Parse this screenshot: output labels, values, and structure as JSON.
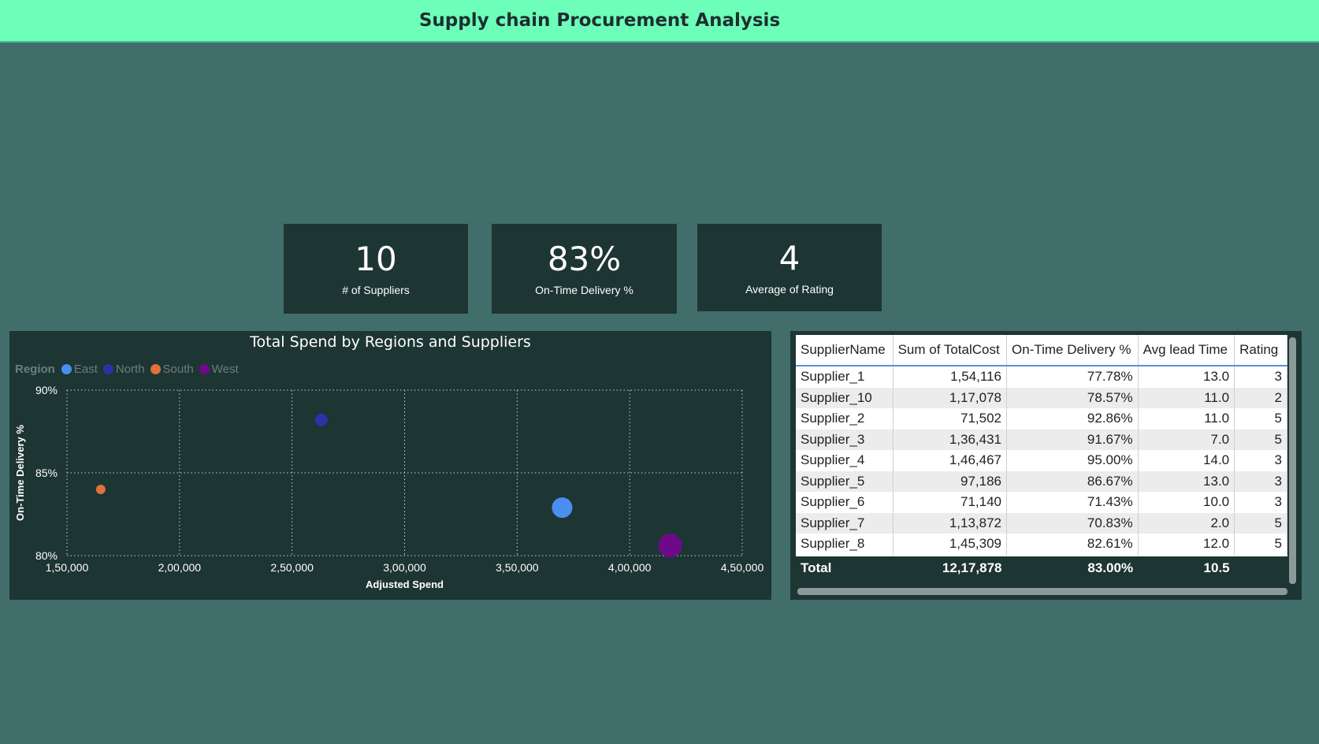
{
  "header": {
    "title": "Supply chain Procurement Analysis"
  },
  "cards": [
    {
      "value": "10",
      "label": "# of Suppliers"
    },
    {
      "value": "83%",
      "label": "On-Time Delivery %"
    },
    {
      "value": "4",
      "label": "Average of Rating"
    }
  ],
  "chart_data": {
    "type": "scatter",
    "title": "Total Spend by Regions and Suppliers",
    "xlabel": "Adjusted Spend",
    "ylabel": "On-Time Delivery %",
    "xlim": [
      150000,
      450000
    ],
    "ylim": [
      80,
      90
    ],
    "x_ticks": [
      "1,50,000",
      "2,00,000",
      "2,50,000",
      "3,00,000",
      "3,50,000",
      "4,00,000",
      "4,50,000"
    ],
    "y_ticks": [
      "80%",
      "85%",
      "90%"
    ],
    "grid": true,
    "legend_title": "Region",
    "legend_position": "top-left",
    "series": [
      {
        "name": "East",
        "color": "#4a8ff0",
        "points": [
          {
            "x": 370000,
            "y": 82.9,
            "size": "large"
          }
        ]
      },
      {
        "name": "North",
        "color": "#2e31a6",
        "points": [
          {
            "x": 263000,
            "y": 88.2,
            "size": "medium"
          }
        ]
      },
      {
        "name": "South",
        "color": "#e0703f",
        "points": [
          {
            "x": 165000,
            "y": 84.0,
            "size": "small"
          }
        ]
      },
      {
        "name": "West",
        "color": "#6e0a8a",
        "points": [
          {
            "x": 418000,
            "y": 80.6,
            "size": "xlarge"
          }
        ]
      }
    ]
  },
  "table": {
    "columns": [
      "SupplierName",
      "Sum of TotalCost",
      "On-Time Delivery %",
      "Avg lead Time",
      "Rating"
    ],
    "rows": [
      [
        "Supplier_1",
        "1,54,116",
        "77.78%",
        "13.0",
        "3"
      ],
      [
        "Supplier_10",
        "1,17,078",
        "78.57%",
        "11.0",
        "2"
      ],
      [
        "Supplier_2",
        "71,502",
        "92.86%",
        "11.0",
        "5"
      ],
      [
        "Supplier_3",
        "1,36,431",
        "91.67%",
        "7.0",
        "5"
      ],
      [
        "Supplier_4",
        "1,46,467",
        "95.00%",
        "14.0",
        "3"
      ],
      [
        "Supplier_5",
        "97,186",
        "86.67%",
        "13.0",
        "3"
      ],
      [
        "Supplier_6",
        "71,140",
        "71.43%",
        "10.0",
        "3"
      ],
      [
        "Supplier_7",
        "1,13,872",
        "70.83%",
        "2.0",
        "5"
      ],
      [
        "Supplier_8",
        "1,45,309",
        "82.61%",
        "12.0",
        "5"
      ]
    ],
    "total": [
      "Total",
      "12,17,878",
      "83.00%",
      "10.5",
      ""
    ]
  }
}
